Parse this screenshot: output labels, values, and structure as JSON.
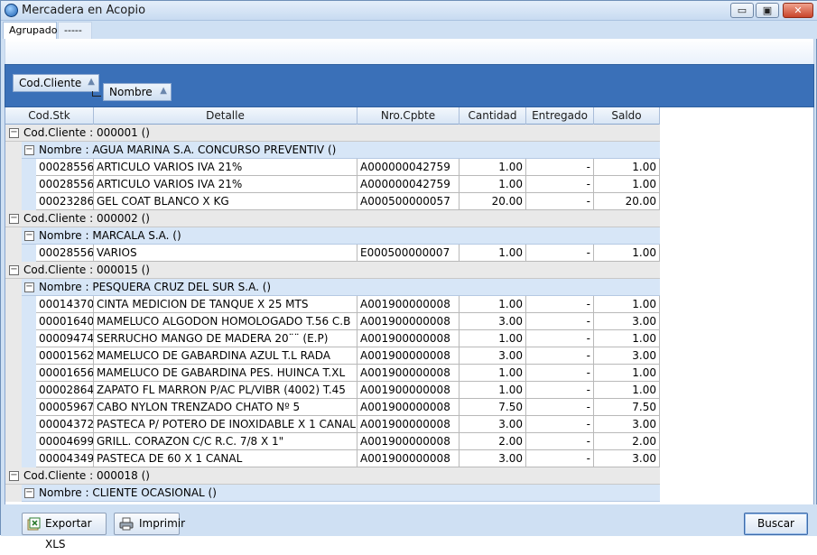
{
  "window": {
    "title": "Mercadera en Acopio",
    "controls": {
      "minimize": "▭",
      "maximize": "▣",
      "close": "✕"
    }
  },
  "tabs": [
    {
      "label": "Agrupado",
      "active": true
    },
    {
      "label": "-----",
      "active": false
    }
  ],
  "group_panel": {
    "chips": [
      {
        "label": "Cod.Cliente",
        "sort": "▲"
      },
      {
        "label": "Nombre",
        "sort": "▲"
      }
    ]
  },
  "grid": {
    "columns": [
      "Cod.Stk",
      "Detalle",
      "Nro.Cpbte",
      "Cantidad",
      "Entregado",
      "Saldo"
    ],
    "groups": [
      {
        "client_label": "Cod.Cliente : 000001 ()",
        "name_label": "Nombre : AGUA MARINA S.A. CONCURSO PREVENTIV ()",
        "rows": [
          [
            "00028556",
            "ARTICULO VARIOS IVA 21%",
            "A000000042759",
            "1.00",
            "-",
            "1.00"
          ],
          [
            "00028556",
            "ARTICULO VARIOS IVA 21%",
            "A000000042759",
            "1.00",
            "-",
            "1.00"
          ],
          [
            "00023286",
            "GEL COAT BLANCO X KG",
            "A000500000057",
            "20.00",
            "-",
            "20.00"
          ]
        ]
      },
      {
        "client_label": "Cod.Cliente : 000002 ()",
        "name_label": "Nombre : MARCALA S.A. ()",
        "rows": [
          [
            "00028556",
            "VARIOS",
            "E000500000007",
            "1.00",
            "-",
            "1.00"
          ]
        ]
      },
      {
        "client_label": "Cod.Cliente : 000015 ()",
        "name_label": "Nombre : PESQUERA CRUZ DEL SUR  S.A. ()",
        "rows": [
          [
            "00014370",
            "CINTA MEDICION DE TANQUE X 25 MTS",
            "A001900000008",
            "1.00",
            "-",
            "1.00"
          ],
          [
            "00001640",
            "MAMELUCO ALGODON  HOMOLOGADO T.56 C.B",
            "A001900000008",
            "3.00",
            "-",
            "3.00"
          ],
          [
            "00009474",
            "SERRUCHO MANGO DE MADERA 20¨¨ (E.P)",
            "A001900000008",
            "1.00",
            "-",
            "1.00"
          ],
          [
            "00001562",
            "MAMELUCO DE GABARDINA AZUL T.L RADA",
            "A001900000008",
            "3.00",
            "-",
            "3.00"
          ],
          [
            "00001656",
            "MAMELUCO DE GABARDINA PES. HUINCA T.XL",
            "A001900000008",
            "1.00",
            "-",
            "1.00"
          ],
          [
            "00002864",
            "ZAPATO FL MARRON P/AC PL/VIBR (4002) T.45",
            "A001900000008",
            "1.00",
            "-",
            "1.00"
          ],
          [
            "00005967",
            "CABO NYLON TRENZADO CHATO Nº  5",
            "A001900000008",
            "7.50",
            "-",
            "7.50"
          ],
          [
            "00004372",
            "PASTECA P/ POTERO DE INOXIDABLE X 1 CANAL",
            "A001900000008",
            "3.00",
            "-",
            "3.00"
          ],
          [
            "00004699",
            "GRILL. CORAZON C/C R.C.    7/8    X    1\"",
            "A001900000008",
            "2.00",
            "-",
            "2.00"
          ],
          [
            "00004349",
            "PASTECA DE  60 X 1 CANAL",
            "A001900000008",
            "3.00",
            "-",
            "3.00"
          ]
        ]
      },
      {
        "client_label": "Cod.Cliente : 000018 ()",
        "name_label": "Nombre : CLIENTE OCASIONAL ()",
        "rows": []
      }
    ],
    "expander_glyph": "−"
  },
  "buttons": {
    "export": "Exportar XLS",
    "print": "Imprimir",
    "search": "Buscar"
  }
}
